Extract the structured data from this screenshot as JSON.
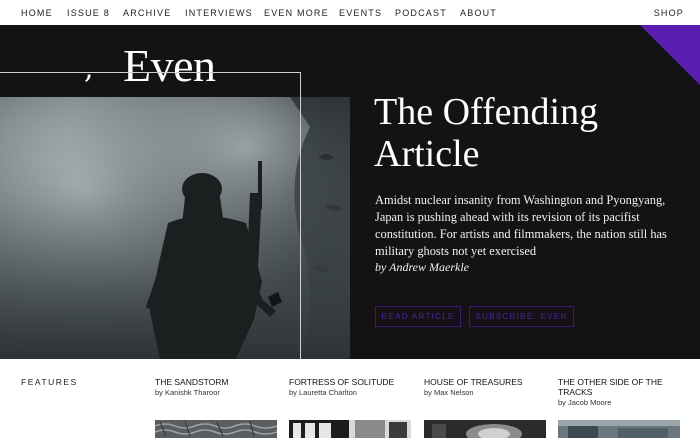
{
  "nav": {
    "items": [
      "HOME",
      "ISSUE 8",
      "ARCHIVE",
      "INTERVIEWS",
      "EVEN MORE",
      "EVENTS",
      "PODCAST",
      "ABOUT"
    ],
    "shop": "SHOP"
  },
  "logo": {
    "mark": ",",
    "word": "Even"
  },
  "hero": {
    "headline_line1": "The Offending",
    "headline_line2": "Article",
    "excerpt": "Amidst nuclear insanity from Washington and Pyongyang, Japan is pushing ahead with its revision of its pacifist constitution. For artists and filmmakers, the nation still has military ghosts not yet exercised",
    "byline": "by Andrew Maerkle",
    "read_button": "READ ARTICLE",
    "subscribe_button": "SUBSCRIBE: EVEN"
  },
  "colors": {
    "accent": "#4b22a8",
    "corner": "#5a1fb0",
    "hero_bg": "#141214"
  },
  "features": {
    "label": "FEATURES",
    "items": [
      {
        "title": "THE SANDSTORM",
        "author": "by Kanishk Tharoor"
      },
      {
        "title": "FORTRESS OF SOLITUDE",
        "author": "by Lauretta Charlton"
      },
      {
        "title": "HOUSE OF TREASURES",
        "author": "by Max Nelson"
      },
      {
        "title": "THE OTHER SIDE OF THE TRACKS",
        "author": "by Jacob Moore"
      }
    ]
  }
}
